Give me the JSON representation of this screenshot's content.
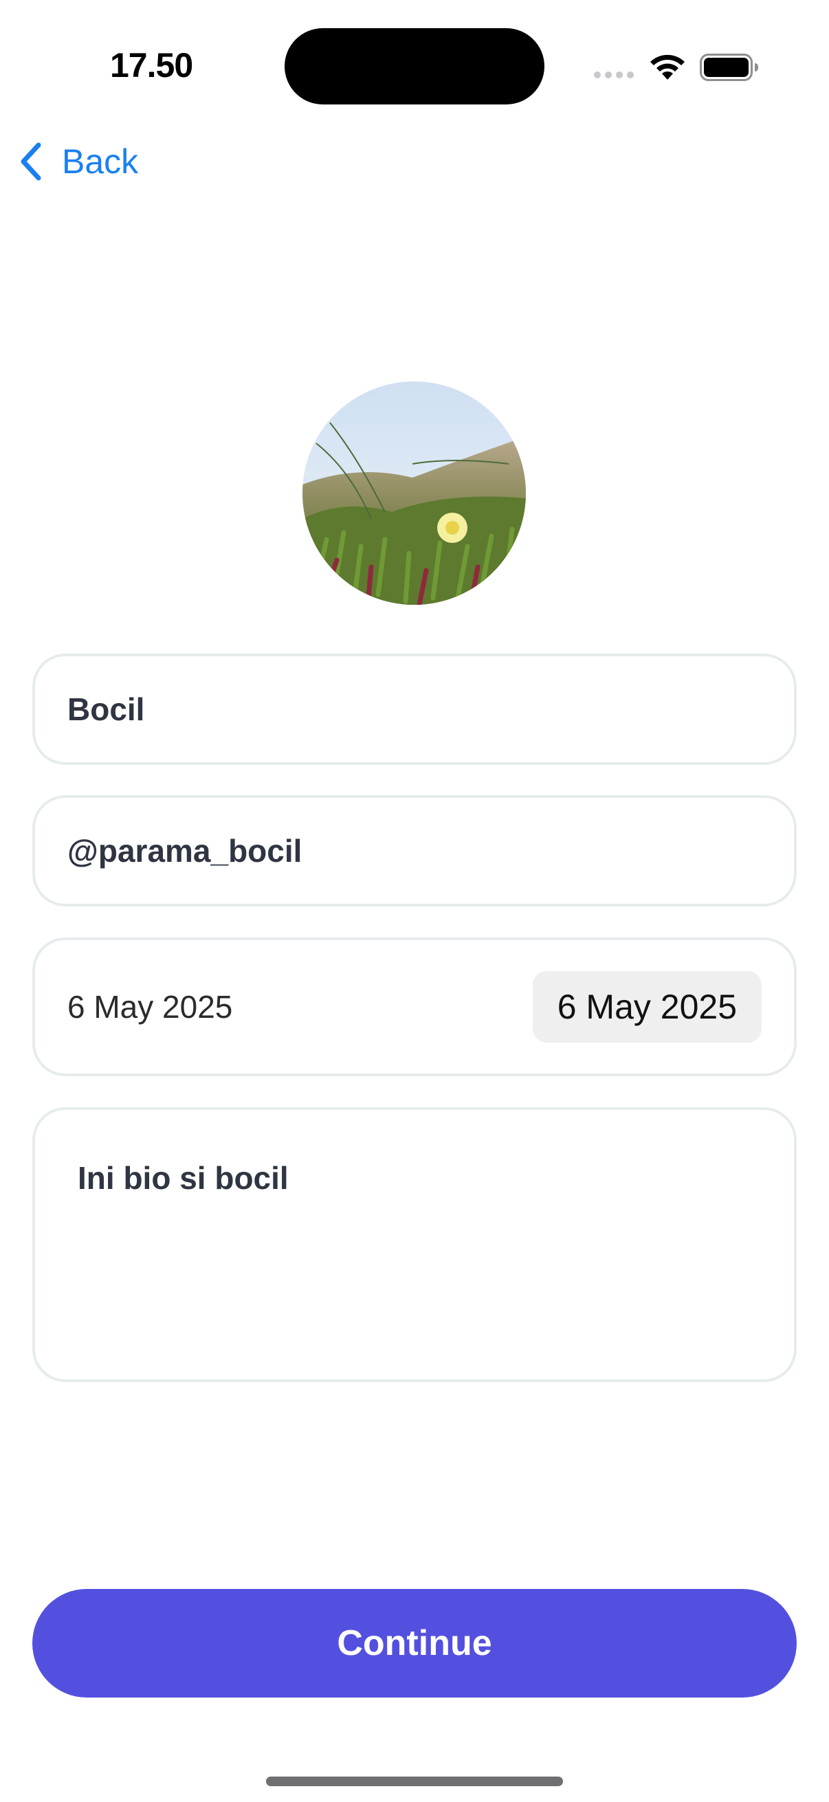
{
  "status_bar": {
    "time": "17.50",
    "icons": [
      "signal-dots-icon",
      "wifi-icon",
      "battery-icon"
    ]
  },
  "nav": {
    "back_label": "Back",
    "back_icon": "chevron-left-icon"
  },
  "profile": {
    "avatar": "photo of yellow flower among succulent plants on a dune",
    "name": "Bocil",
    "username": "@parama_bocil",
    "date_label": "6 May 2025",
    "date_picker_value": "6 May 2025",
    "bio": "Ini bio si bocil"
  },
  "actions": {
    "continue_label": "Continue"
  },
  "colors": {
    "accent_blue": "#1a80f0",
    "button_purple": "#5350e0",
    "field_border": "#e6ecee",
    "date_pill_bg": "#efefef"
  }
}
